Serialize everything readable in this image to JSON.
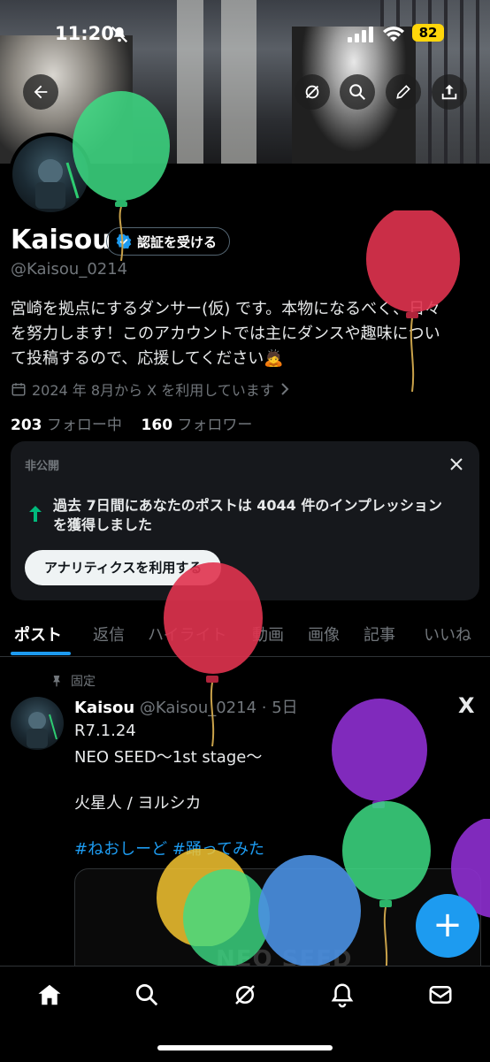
{
  "status_bar": {
    "time": "11:20",
    "battery": "82"
  },
  "profile": {
    "name": "Kaisou",
    "verify_label": "認証を受ける",
    "handle": "@Kaisou_0214",
    "bio_line1": "宮崎を拠点にするダンサー(仮) です。本物になるべく、日々",
    "bio_line2": "を努力します！このアカウントでは主にダンスや趣味につい",
    "bio_line3": "て投稿するので、応援してください🙇",
    "joined": "2024 年 8月から X を利用しています",
    "following_count": "203",
    "following_label": "フォロー中",
    "followers_count": "160",
    "followers_label": "フォロワー"
  },
  "card": {
    "private_label": "非公開",
    "text_line1": "過去 7日間にあなたのポストは 4044 件のインプレッション",
    "text_line2": "を獲得しました",
    "button_label": "アナリティクスを利用する"
  },
  "tabs": [
    "ポスト",
    "返信",
    "ハイライト",
    "動画",
    "画像",
    "記事",
    "いいね"
  ],
  "post": {
    "pinned_label": "固定",
    "author": "Kaisou",
    "meta": "@Kaisou_0214 · 5日",
    "line1": "R7.1.24",
    "line2": "NEO SEED〜1st stage〜",
    "line3": "火星人 / ヨルシカ",
    "hashtags": "#ねおしーど #踊ってみた",
    "media_text": "NEO SEED",
    "x_logo": "X"
  },
  "fab_label": "+",
  "colors": {
    "accent": "#1d9bf0",
    "battery": "#ffd60a",
    "background": "#000000"
  },
  "icons": [
    "back-icon",
    "grok-icon",
    "search-icon",
    "edit-icon",
    "share-icon",
    "calendar-icon",
    "chevron-right-icon",
    "close-icon",
    "arrow-up-icon",
    "pin-icon",
    "home-icon",
    "explore-icon",
    "grok-nav-icon",
    "bell-icon",
    "mail-icon"
  ]
}
